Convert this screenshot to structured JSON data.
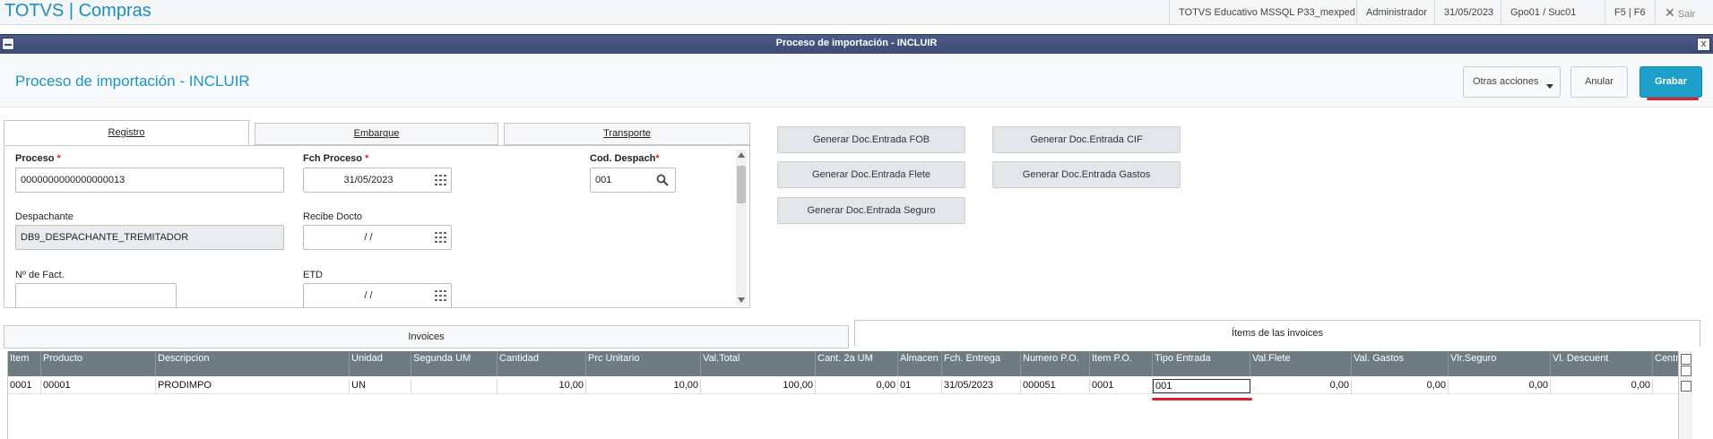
{
  "appbar": {
    "title": "TOTVS | Compras",
    "environment": "TOTVS Educativo MSSQL P33_mexped",
    "user": "Administrador",
    "date": "31/05/2023",
    "branch": "Gpo01 / Suc01",
    "shortcuts": "F5 | F6",
    "exit_label": "Sair"
  },
  "window": {
    "title": "Proceso de importación - INCLUIR",
    "close_label": "x"
  },
  "header": {
    "title": "Proceso de importación - INCLUIR",
    "other_actions": "Otras acciones",
    "cancel": "Anular",
    "save": "Grabar"
  },
  "tabs": [
    {
      "label": "Registro"
    },
    {
      "label": "Embarque"
    },
    {
      "label": "Transporte"
    }
  ],
  "form": {
    "proceso_label": "Proceso",
    "proceso_value": "0000000000000000013",
    "fch_proceso_label": "Fch Proceso",
    "fch_proceso_value": "31/05/2023",
    "cod_despach_label": "Cod. Despach",
    "cod_despach_value": "001",
    "despachante_label": "Despachante",
    "despachante_value": "DB9_DESPACHANTE_TREMITADOR",
    "recibe_docto_label": "Recibe Docto",
    "recibe_docto_value": "/ /",
    "nfact_label": "Nº de Fact.",
    "nfact_value": "",
    "etd_label": "ETD",
    "etd_value": "/ /",
    "required_mark": "*"
  },
  "actions": {
    "fob": "Generar Doc.Entrada FOB",
    "cif": "Generar Doc.Entrada CIF",
    "flete": "Generar Doc.Entrada Flete",
    "gastos": "Generar Doc.Entrada Gastos",
    "seguro": "Generar Doc.Entrada Seguro"
  },
  "bottom_tabs": {
    "invoices": "Invoices",
    "items": "Ítems de las invoices"
  },
  "grid": {
    "columns": [
      "Item",
      "Producto",
      "Descripcion",
      "Unidad",
      "Segunda UM",
      "Cantidad",
      "Prc Unitario",
      "Val.Total",
      "Cant. 2a UM",
      "Almacen",
      "Fch. Entrega",
      "Numero P.O.",
      "Item P.O.",
      "Tipo Entrada",
      "Val.Flete",
      "Val. Gastos",
      "Vlr.Seguro",
      "Vl. Descuent",
      "Centr"
    ],
    "row": [
      "0001",
      "00001",
      "PRODIMPO",
      "UN",
      "",
      "10,00",
      "10,00",
      "100,00",
      "0,00",
      "01",
      "31/05/2023",
      "000051",
      "0001",
      "001",
      "0,00",
      "0,00",
      "0,00",
      "0,00",
      ""
    ]
  },
  "colors": {
    "brand": "#1a8fbf",
    "primary_button": "#1e9fc9",
    "window_bar": "#3d4c74",
    "grid_header": "#6e7b82",
    "highlight_underline": "#e0202a"
  }
}
